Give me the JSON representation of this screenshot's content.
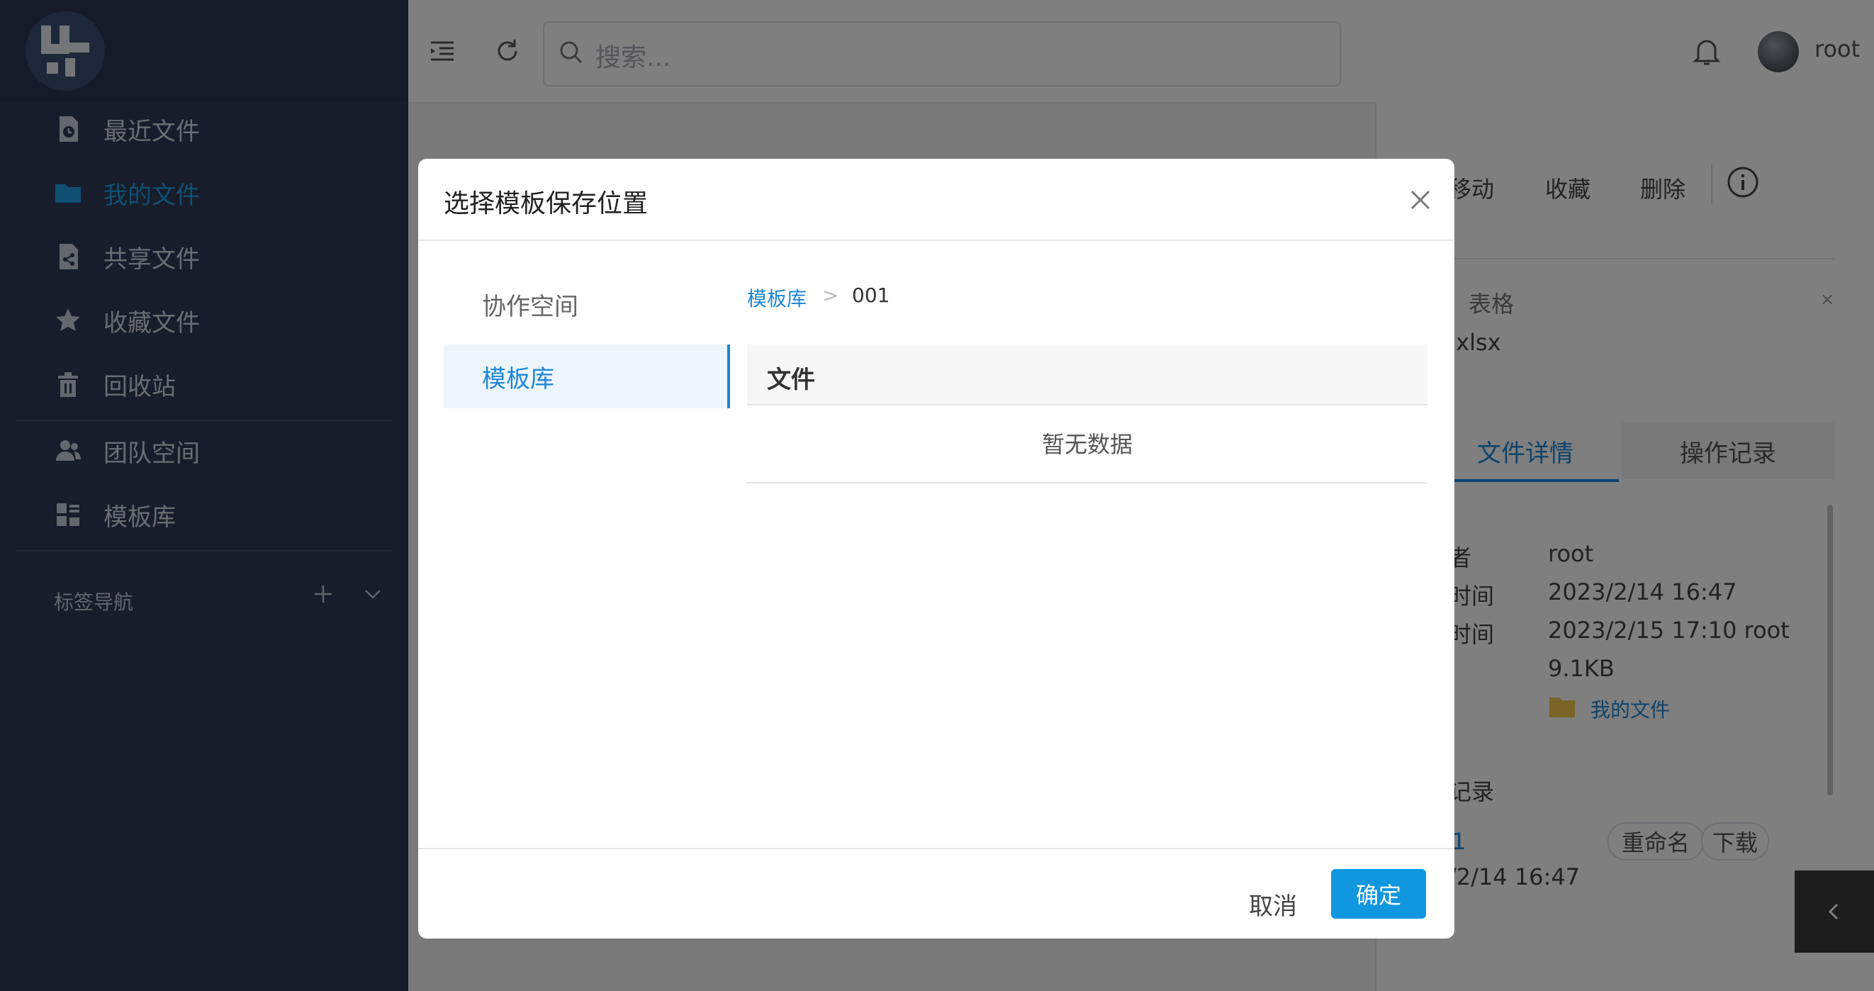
{
  "sidebar": {
    "items": [
      {
        "label": "最近文件",
        "icon": "recent-file-icon"
      },
      {
        "label": "我的文件",
        "icon": "folder-icon"
      },
      {
        "label": "共享文件",
        "icon": "share-file-icon"
      },
      {
        "label": "收藏文件",
        "icon": "star-icon"
      },
      {
        "label": "回收站",
        "icon": "trash-icon"
      },
      {
        "label": "团队空间",
        "icon": "team-icon"
      },
      {
        "label": "模板库",
        "icon": "template-icon"
      }
    ],
    "tag_nav_label": "标签导航",
    "active_color": "#1fa0e6"
  },
  "topbar": {
    "search_placeholder": "搜索...",
    "username": "root"
  },
  "background_panel": {
    "actions": [
      "移动",
      "收藏",
      "删除"
    ],
    "file_type": "表格",
    "file_name_fragment": ".xlsx",
    "tabs": [
      "文件详情",
      "操作记录"
    ],
    "details": [
      {
        "label": "者",
        "value": "root"
      },
      {
        "label": "时间",
        "value": "2023/2/14 16:47"
      },
      {
        "label": "时间",
        "value": "2023/2/15 17:10 root"
      },
      {
        "label": "",
        "value": "9.1KB"
      },
      {
        "label": "",
        "value": "我的文件"
      }
    ],
    "history_heading": "记录",
    "history_version": "1",
    "history_time": "/2/14 16:47",
    "history_buttons": [
      "重命名",
      "下载"
    ]
  },
  "dialog": {
    "title": "选择模板保存位置",
    "left_items": [
      "协作空间",
      "模板库"
    ],
    "breadcrumb": [
      "模板库",
      ">",
      "001"
    ],
    "table_header": "文件",
    "empty_text": "暂无数据",
    "cancel_label": "取消",
    "ok_label": "确定",
    "accent_color": "#1196e0"
  }
}
